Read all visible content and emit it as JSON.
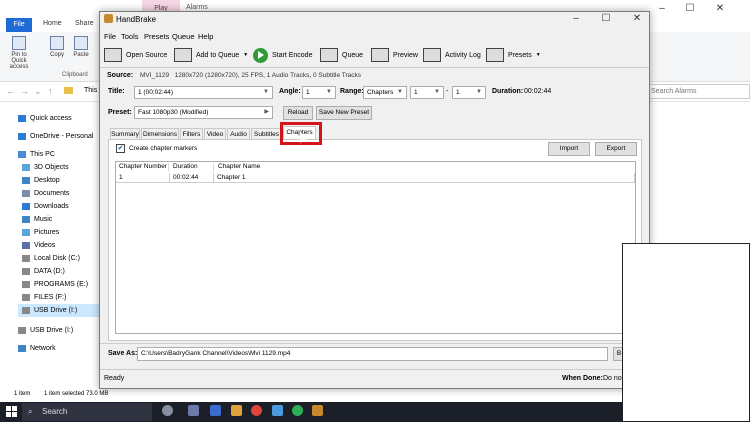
{
  "explorer": {
    "play_tab": "Play",
    "alarms_tab": "Alarms",
    "file_tab": "File",
    "ribbon_tabs": [
      "Home",
      "Share"
    ],
    "ribbon_items": [
      "Pin to Quick access",
      "Copy",
      "Paste"
    ],
    "clipboard_label": "Clipboard",
    "address": "This P",
    "search_placeholder": "Search Alarms",
    "nav": [
      "Quick access",
      "OneDrive - Personal",
      "This PC",
      "3D Objects",
      "Desktop",
      "Documents",
      "Downloads",
      "Music",
      "Pictures",
      "Videos",
      "Local Disk (C:)",
      "DATA (D:)",
      "PROGRAMS (E:)",
      "FILES (F:)",
      "USB Drive (I:)",
      "USB Drive (I:)",
      "Network"
    ],
    "status_items": "1 item",
    "status_selected": "1 item selected  73.0 MB"
  },
  "taskbar": {
    "search": "Search"
  },
  "handbrake": {
    "title": "HandBrake",
    "menu": [
      "File",
      "Tools",
      "Presets",
      "Queue",
      "Help"
    ],
    "toolbar": {
      "open_source": "Open Source",
      "add_to_queue": "Add to Queue",
      "start_encode": "Start Encode",
      "queue": "Queue",
      "preview": "Preview",
      "activity_log": "Activity Log",
      "presets": "Presets"
    },
    "source_label": "Source:",
    "source_name": "MVI_1129",
    "source_info": "1280x720 (1280x720), 25 FPS, 1 Audio Tracks, 0 Subtitle Tracks",
    "title_label": "Title:",
    "title_value": "1 (00:02:44)",
    "angle_label": "Angle:",
    "angle_value": "1",
    "range_label": "Range:",
    "range_value": "Chapters",
    "range_start": "1",
    "range_dash": "-",
    "range_end": "1",
    "duration_label": "Duration:",
    "duration_value": "00:02:44",
    "preset_label": "Preset:",
    "preset_value": "Fast 1080p30  (Modified)",
    "reload_button": "Reload",
    "save_preset_button": "Save New Preset",
    "tabs": [
      "Summary",
      "Dimensions",
      "Filters",
      "Video",
      "Audio",
      "Subtitles",
      "Chapters"
    ],
    "active_tab": "Chapters",
    "create_markers_label": "Create chapter markers",
    "create_markers_checked": "✔",
    "import_button": "Import",
    "export_button": "Export",
    "table": {
      "headers": [
        "Chapter Number",
        "Duration",
        "Chapter Name"
      ],
      "rows": [
        [
          "1",
          "00:02:44",
          "Chapter 1"
        ]
      ]
    },
    "save_as_label": "Save As:",
    "save_as_value": "C:\\Users\\BadryGank Channel\\Videos\\Mvi 1129.mp4",
    "browse_button": "B",
    "status": "Ready",
    "when_done_label": "When Done:",
    "when_done_value": "Do no"
  },
  "colors": {
    "highlight": "#d4141b",
    "start_encode": "#2e9b36",
    "file_tab": "#1e6ad6"
  }
}
